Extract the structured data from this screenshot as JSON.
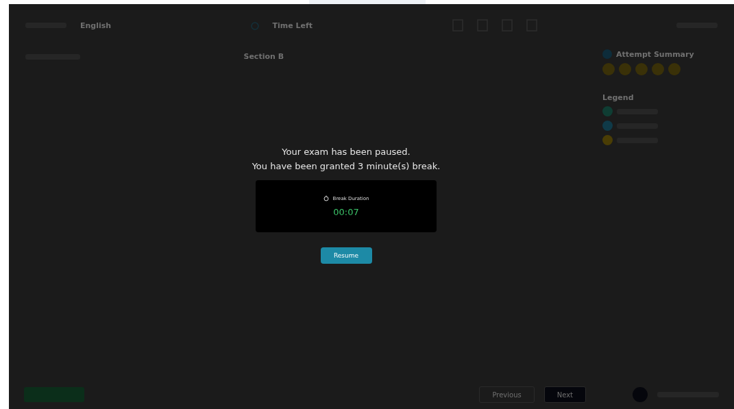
{
  "header": {
    "language": "English",
    "timer_label": "Time Left"
  },
  "question": {
    "section": "Section B"
  },
  "summary": {
    "title": "Attempt Summary",
    "legend_title": "Legend",
    "legend": [
      {
        "color": "#0f3d33"
      },
      {
        "color": "#0f3a48"
      },
      {
        "color": "#4a3d05"
      }
    ]
  },
  "pause": {
    "messages": [
      "Your exam has been paused.",
      "You have been granted 3 minute(s) break."
    ],
    "timer": {
      "label": "Break Duration",
      "value": "00:07"
    },
    "resume": "Resume"
  },
  "footer": {
    "previous": "Previous",
    "next": "Next"
  }
}
